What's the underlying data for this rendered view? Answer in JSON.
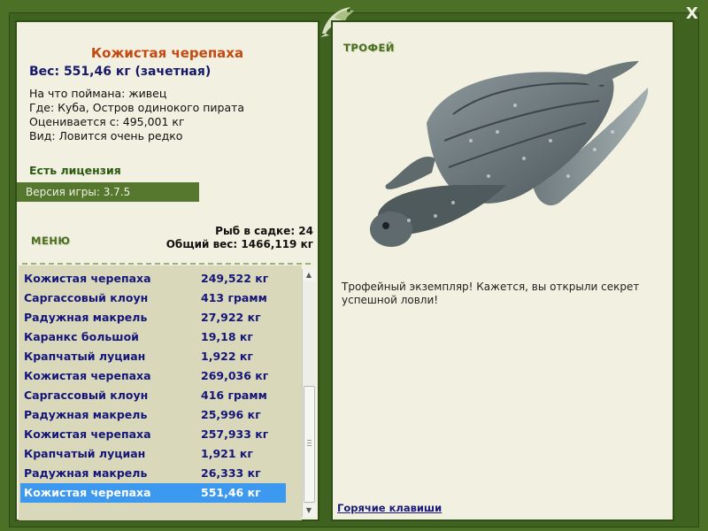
{
  "window": {
    "close_label": "X"
  },
  "fish": {
    "title": "Кожистая черепаха",
    "weight": "Вес: 551,46 кг (зачетная)",
    "caught_with": "На что поймана: живец",
    "location": "Где: Куба, Остров одинокого пирата",
    "valued_from": "Оценивается с: 495,001 кг",
    "rarity": "Вид: Ловится очень редко"
  },
  "license": "Есть лицензия",
  "version": "Версия игры: 3.7.5",
  "menu_label": "МЕНЮ",
  "stats": {
    "fish_in_keepnet": "Рыб в садке: 24",
    "total_weight": "Общий вес: 1466,119 кг"
  },
  "catch_list": [
    {
      "name": "Кожистая черепаха",
      "weight": "249,522 кг"
    },
    {
      "name": "Саргассовый клоун",
      "weight": "413 грамм"
    },
    {
      "name": "Радужная макрель",
      "weight": "27,922 кг"
    },
    {
      "name": "Каранкс большой",
      "weight": "19,18 кг"
    },
    {
      "name": "Крапчатый луциан",
      "weight": "1,922 кг"
    },
    {
      "name": "Кожистая черепаха",
      "weight": "269,036 кг"
    },
    {
      "name": "Саргассовый клоун",
      "weight": "416 грамм"
    },
    {
      "name": "Радужная макрель",
      "weight": "25,996 кг"
    },
    {
      "name": "Кожистая черепаха",
      "weight": "257,933 кг"
    },
    {
      "name": "Крапчатый луциан",
      "weight": "1,921 кг"
    },
    {
      "name": "Радужная макрель",
      "weight": "26,333 кг"
    },
    {
      "name": "Кожистая черепаха",
      "weight": "551,46 кг"
    }
  ],
  "selected_index": 11,
  "trophy": {
    "label": "ТРОФЕЙ",
    "text": "Трофейный экземпляр! Кажется, вы открыли секрет успешной ловли!",
    "hotkeys": "Горячие клавиши"
  },
  "colors": {
    "frame": "#4c7026",
    "panel": "#f2f0e0",
    "title": "#c34a12",
    "list_text": "#14167a",
    "selection": "#3d99f0"
  }
}
